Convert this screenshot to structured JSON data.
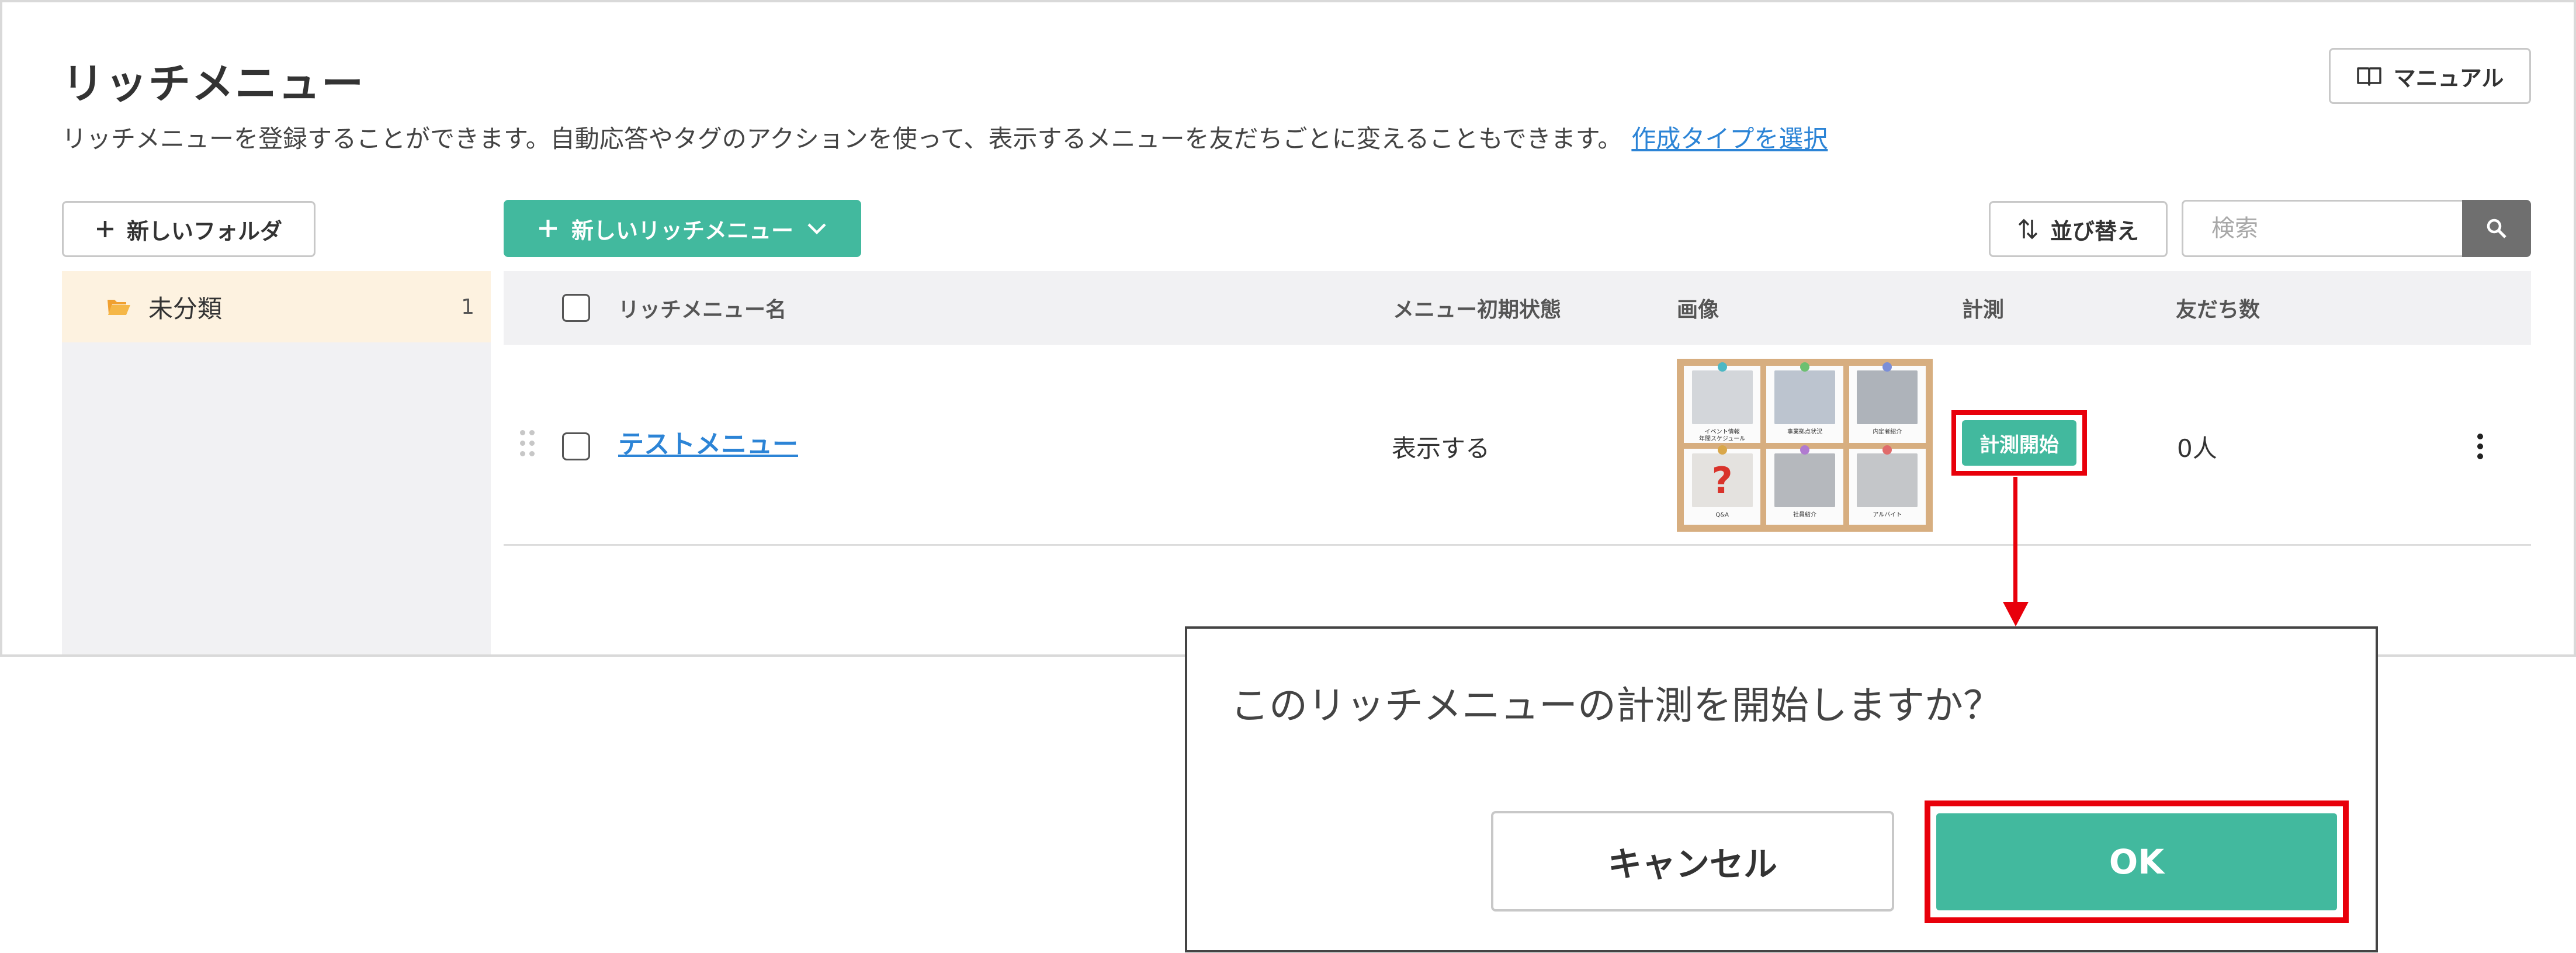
{
  "page": {
    "title": "リッチメニュー",
    "description": "リッチメニューを登録することができます。自動応答やタグのアクションを使って、表示するメニューを友だちごとに変えることもできます。",
    "description_link": "作成タイプを選択",
    "manual_label": "マニュアル"
  },
  "toolbar": {
    "new_folder_label": "新しいフォルダ",
    "new_rich_menu_label": "新しいリッチメニュー",
    "sort_label": "並び替え",
    "search_placeholder": "検索"
  },
  "sidebar": {
    "folders": [
      {
        "name": "未分類",
        "count": "1"
      }
    ]
  },
  "table": {
    "columns": [
      "リッチメニュー名",
      "メニュー初期状態",
      "画像",
      "計測",
      "友だち数"
    ],
    "rows": [
      {
        "name": "テストメニュー",
        "initial_state": "表示する",
        "measure_label": "計測開始",
        "friends": "0人",
        "thumbnail_tiles": [
          {
            "label": "イベント情報\n年間スケジュール",
            "pin": "#4cb8c4"
          },
          {
            "label": "事業拠点状況",
            "pin": "#6cc070"
          },
          {
            "label": "内定者紹介",
            "pin": "#7b8ed8"
          },
          {
            "label": "Q&A",
            "pin": "#d9a74a"
          },
          {
            "label": "社員紹介",
            "pin": "#b07ad0"
          },
          {
            "label": "アルバイト",
            "pin": "#e06b6b"
          }
        ]
      }
    ]
  },
  "dialog": {
    "message": "このリッチメニューの計測を開始しますか？",
    "cancel_label": "キャンセル",
    "ok_label": "OK"
  },
  "colors": {
    "accent": "#42b99e",
    "link": "#2c84d6",
    "highlight": "#e8000b",
    "folder_bg": "#fdf2e0"
  }
}
